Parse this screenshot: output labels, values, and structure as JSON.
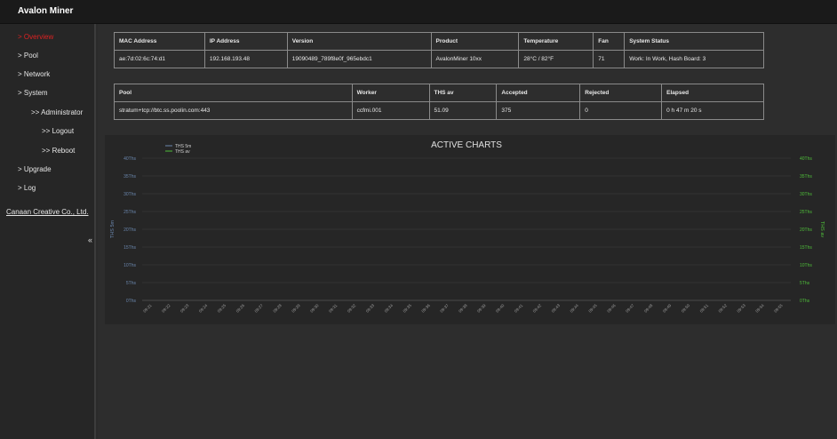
{
  "app": {
    "title": "Avalon Miner"
  },
  "sidebar": {
    "items": [
      {
        "label": "> Overview",
        "active": true
      },
      {
        "label": "> Pool"
      },
      {
        "label": "> Network"
      },
      {
        "label": "> System"
      },
      {
        "label": ">> Administrator"
      },
      {
        "label": ">> Logout"
      },
      {
        "label": ">> Reboot"
      },
      {
        "label": "> Upgrade"
      },
      {
        "label": "> Log"
      }
    ],
    "company_link": "Canaan Creative Co., Ltd.",
    "collapse_icon": "«"
  },
  "device_table": {
    "headers": [
      "MAC Address",
      "IP Address",
      "Version",
      "Product",
      "Temperature",
      "Fan",
      "System Status"
    ],
    "row": [
      "ae:7d:02:6c:74:d1",
      "192.168.193.48",
      "19090489_789f8e0f_965ebdc1",
      "AvalonMiner 10xx",
      "28°C / 82°F",
      "71",
      "Work: In Work, Hash Board: 3"
    ]
  },
  "pool_table": {
    "headers": [
      "Pool",
      "Worker",
      "THS av",
      "Accepted",
      "Rejected",
      "Elapsed"
    ],
    "row": [
      "stratum+tcp://btc.ss.poolin.com:443",
      "ccfmi.001",
      "51.09",
      "375",
      "0",
      "0 h 47 m 20 s"
    ]
  },
  "chart_data": {
    "type": "line",
    "title": "ACTIVE CHARTS",
    "legend": [
      "THS 5m",
      "THS av"
    ],
    "legend_placement": "top-left",
    "ylabel_left": "THS 5m",
    "ylabel_right": "THS av",
    "y_ticks": [
      "40Ths",
      "35Ths",
      "30Ths",
      "25Ths",
      "20Ths",
      "15Ths",
      "10Ths",
      "5Ths",
      "0Ths"
    ],
    "ylim": [
      0,
      40
    ],
    "x_ticks": [
      "09:21",
      "09:22",
      "09:23",
      "09:24",
      "09:25",
      "09:26",
      "09:27",
      "09:28",
      "09:29",
      "09:30",
      "09:31",
      "09:32",
      "09:33",
      "09:34",
      "09:35",
      "09:36",
      "09:37",
      "09:38",
      "09:39",
      "09:40",
      "09:41",
      "09:42",
      "09:43",
      "09:44",
      "09:45",
      "09:46",
      "09:47",
      "09:48",
      "09:49",
      "09:50",
      "09:51",
      "09:52",
      "09:53",
      "09:54",
      "09:55"
    ],
    "series": [
      {
        "name": "THS 5m",
        "color": "#6a86ad",
        "values": []
      },
      {
        "name": "THS av",
        "color": "#4fbf3a",
        "values": []
      }
    ],
    "grid": true
  },
  "colors": {
    "accent_active": "#dd2222",
    "left_axis": "#6a86ad",
    "right_axis": "#4fbf3a"
  }
}
